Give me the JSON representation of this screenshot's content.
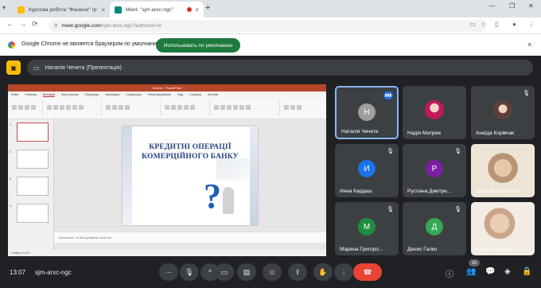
{
  "browser": {
    "tabs": [
      {
        "title": "Курсова робота \"Фінанси\" гр",
        "favicon_color": "#fbbc04"
      },
      {
        "title": "Meet: \"sjm-arxc-ngc\"",
        "favicon_color": "#00897b"
      }
    ],
    "url_host": "meet.google.com",
    "url_path": "/sjm-arxc-ngc?authuser=0",
    "infobar_message": "Google Chrome не является браузером по умолчанию",
    "infobar_button": "Использовать по умолчанию",
    "icons": {
      "new_tab": "+",
      "close": "×",
      "back": "←",
      "forward": "→",
      "reload": "⟳"
    }
  },
  "meet": {
    "presenting_label": "Наталія Чечета (Презентація)",
    "meeting_code": "sjm-arxc-ngc",
    "time": "13:07",
    "participant_count": "10",
    "slide": {
      "title_line1": "КРЕДИТНІ ОПЕРАЦІЇ",
      "title_line2": "КОМЕРЦІЙНОГО БАНКУ"
    },
    "ppt": {
      "window_title": "Чечета - PowerPoint",
      "tabs": [
        "Файл",
        "Главная",
        "Вставка",
        "Конструктор",
        "Переходы",
        "Анимация",
        "Слайд-шоу",
        "Рецензирование",
        "Вид",
        "Справка",
        "Acrobat"
      ],
      "selected_tab": "Вставка",
      "notes_placeholder": "Щелкните, чтобы добавить заметки",
      "status": "Слайд 1 из 18",
      "thumb_numbers": [
        "1",
        "2",
        "3",
        "4"
      ]
    },
    "participants": [
      {
        "name": "Наталія Чечета",
        "initial": "Н",
        "avatar_color": "#9e9e9e",
        "speaking": true
      },
      {
        "name": "Надія Матрюк",
        "initial": "",
        "avatar_color": "#c2185b",
        "photo": true
      },
      {
        "name": "Анаїда Корівчак",
        "initial": "",
        "avatar_color": "#f5e6d8",
        "photo": true,
        "muted": true
      },
      {
        "name": "Инна Кардаш",
        "initial": "И",
        "avatar_color": "#1a73e8",
        "muted": true
      },
      {
        "name": "Руслана Дмитре...",
        "initial": "Р",
        "avatar_color": "#7b1fa2",
        "muted": true
      },
      {
        "name": "Вікторія Папченко",
        "initial": "",
        "avatar_color": "#d7c1a8",
        "video": true
      },
      {
        "name": "Марина Григоро...",
        "initial": "М",
        "avatar_color": "#1e8e3e",
        "muted": true
      },
      {
        "name": "Денис Галко",
        "initial": "Д",
        "avatar_color": "#34a853",
        "muted": true
      },
      {
        "name": "Юлія Альохіна",
        "initial": "",
        "avatar_color": "#d9c3b0",
        "video": true
      }
    ],
    "controls": [
      "more-options",
      "mic",
      "present-options",
      "camera",
      "captions",
      "emoji",
      "present-screen",
      "raise-hand",
      "more",
      "hang-up"
    ],
    "right_controls": [
      "info",
      "people",
      "chat",
      "activities",
      "host-controls"
    ]
  }
}
